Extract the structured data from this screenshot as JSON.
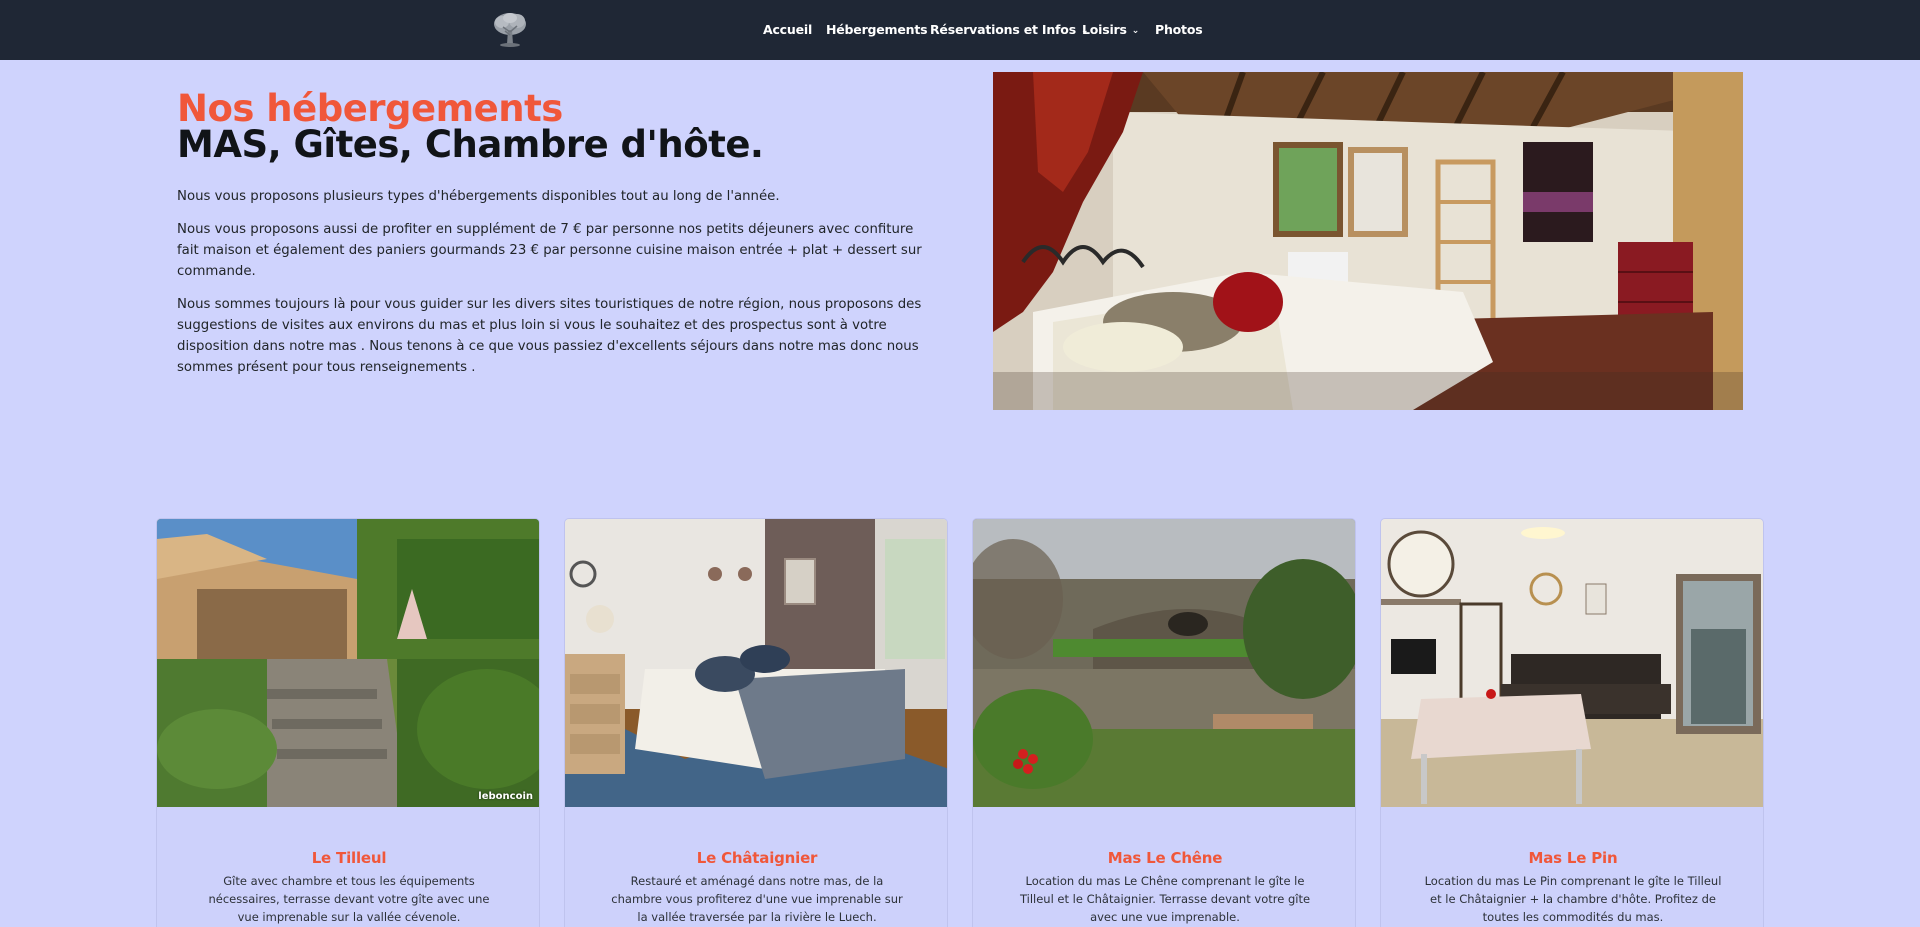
{
  "nav": {
    "items": [
      {
        "label": "Accueil"
      },
      {
        "label": "Hébergements"
      },
      {
        "label": "Réservations et Infos"
      },
      {
        "label": "Loisirs"
      },
      {
        "label": "Photos"
      }
    ]
  },
  "hero": {
    "title_accent": "Nos hébergements",
    "title_main": "MAS, Gîtes, Chambre d'hôte.",
    "paragraphs": [
      "Nous vous proposons plusieurs types d'hébergements disponibles tout au long de l'année.",
      "Nous vous proposons aussi de profiter en supplément de 7 € par personne nos petits déjeuners avec confiture fait maison et également des paniers gourmands 23 € par personne cuisine maison entrée + plat + dessert sur commande.",
      "Nous sommes toujours là pour vous guider sur les divers sites touristiques de notre région, nous proposons des suggestions de visites aux environs du mas et plus loin si vous le souhaitez et des prospectus sont à votre disposition dans notre mas . Nous tenons à ce que vous passiez d'excellents séjours dans notre mas donc nous sommes présent pour tous renseignements ."
    ]
  },
  "cards": [
    {
      "title": "Le Tilleul",
      "text": "Gîte avec chambre et tous les équipements nécessaires, terrasse devant votre gîte avec une vue imprenable sur la vallée cévenole.",
      "watermark": "leboncoin"
    },
    {
      "title": "Le Châtaignier",
      "text": "Restauré et aménagé dans notre mas, de la chambre vous profiterez d'une vue imprenable sur la vallée traversée par la rivière le Luech."
    },
    {
      "title": "Mas Le Chêne",
      "text": "Location du mas Le Chêne comprenant le gîte le Tilleul et le Châtaignier. Terrasse devant votre gîte avec une vue imprenable."
    },
    {
      "title": "Mas Le Pin",
      "text": "Location du mas Le Pin comprenant le gîte le Tilleul et le Châtaignier + la chambre d'hôte. Profitez de toutes les commodités du mas."
    }
  ],
  "colors": {
    "page_bg": "#cfd3fd",
    "navbar_bg": "#1f2735",
    "accent": "#f0573a"
  },
  "icons": {
    "logo": "tree-logo-icon",
    "dropdown": "chevron-down-icon"
  }
}
